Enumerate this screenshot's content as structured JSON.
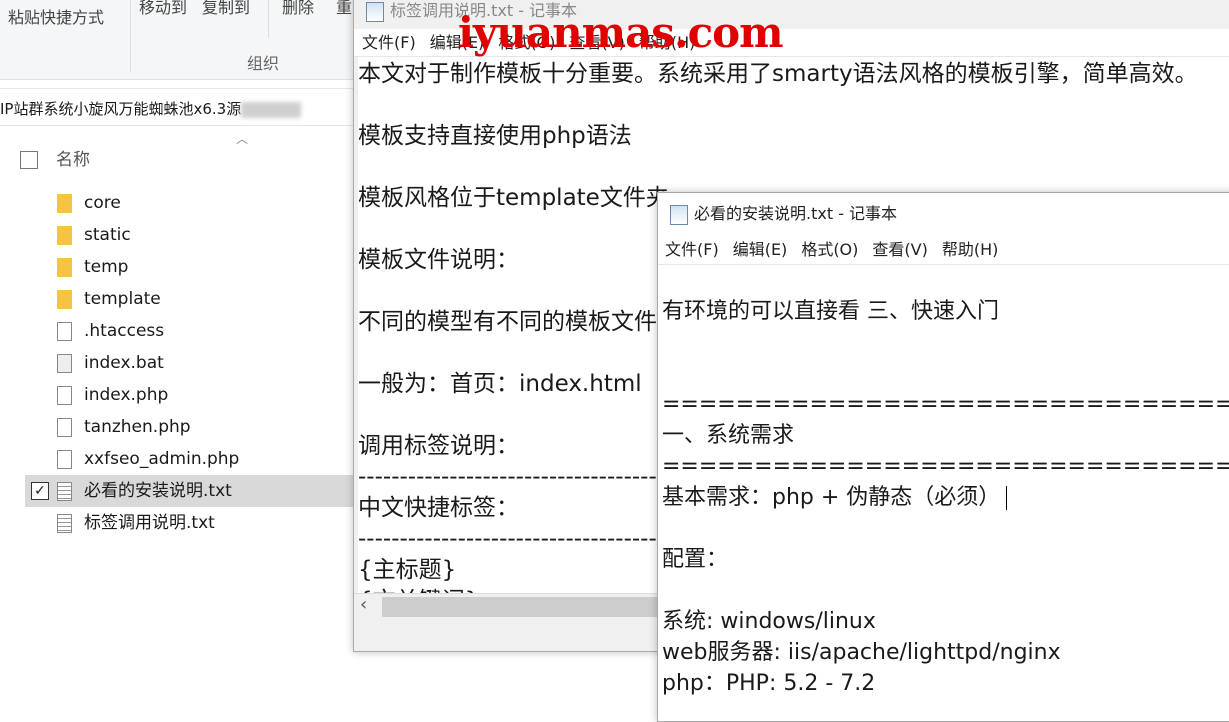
{
  "explorer": {
    "ribbon": {
      "paste_shortcut": "粘贴快捷方式",
      "move_to": "移动到",
      "copy_to": "复制到",
      "delete": "删除",
      "rename": "重",
      "group_label": "组织"
    },
    "address": "IP站群系统小旋风万能蜘蛛池x6.3源",
    "column_name": "名称",
    "files": [
      {
        "name": "core",
        "type": "folder"
      },
      {
        "name": "static",
        "type": "folder"
      },
      {
        "name": "temp",
        "type": "folder"
      },
      {
        "name": "template",
        "type": "folder"
      },
      {
        "name": ".htaccess",
        "type": "file"
      },
      {
        "name": "index.bat",
        "type": "bat"
      },
      {
        "name": "index.php",
        "type": "file"
      },
      {
        "name": "tanzhen.php",
        "type": "file"
      },
      {
        "name": "xxfseo_admin.php",
        "type": "file"
      },
      {
        "name": "必看的安装说明.txt",
        "type": "txt",
        "selected": true
      },
      {
        "name": "标签调用说明.txt",
        "type": "txt"
      }
    ]
  },
  "notepad_back": {
    "title": "标签调用说明.txt - 记事本",
    "menu": [
      "文件(F)",
      "编辑(E)",
      "格式(O)",
      "查看(V)",
      "帮助(H)"
    ],
    "lines": [
      "本文对于制作模板十分重要。系统采用了smarty语法风格的模板引擎，简单高效。",
      "",
      "模板支持直接使用php语法",
      "",
      "模板风格位于template文件夹",
      "",
      "模板文件说明：",
      "",
      "不同的模型有不同的模板文件",
      "",
      "一般为：首页：index.html",
      "",
      "调用标签说明：",
      "---------------------------------------------",
      "中文快捷标签：",
      "---------------------------------------------",
      "{主标题}",
      "{文关键词}"
    ]
  },
  "notepad_front": {
    "title": "必看的安装说明.txt - 记事本",
    "menu": [
      "文件(F)",
      "编辑(E)",
      "格式(O)",
      "查看(V)",
      "帮助(H)"
    ],
    "lines": [
      "",
      "有环境的可以直接看 三、快速入门",
      "",
      "",
      "==========================================",
      "一、系统需求",
      "==========================================",
      "基本需求：php + 伪静态（必须）",
      "",
      "配置：",
      "",
      "系统: windows/linux",
      "web服务器: iis/apache/lighttpd/nginx",
      "php：PHP: 5.2 - 7.2"
    ]
  },
  "watermark": "iyuanmas.com"
}
